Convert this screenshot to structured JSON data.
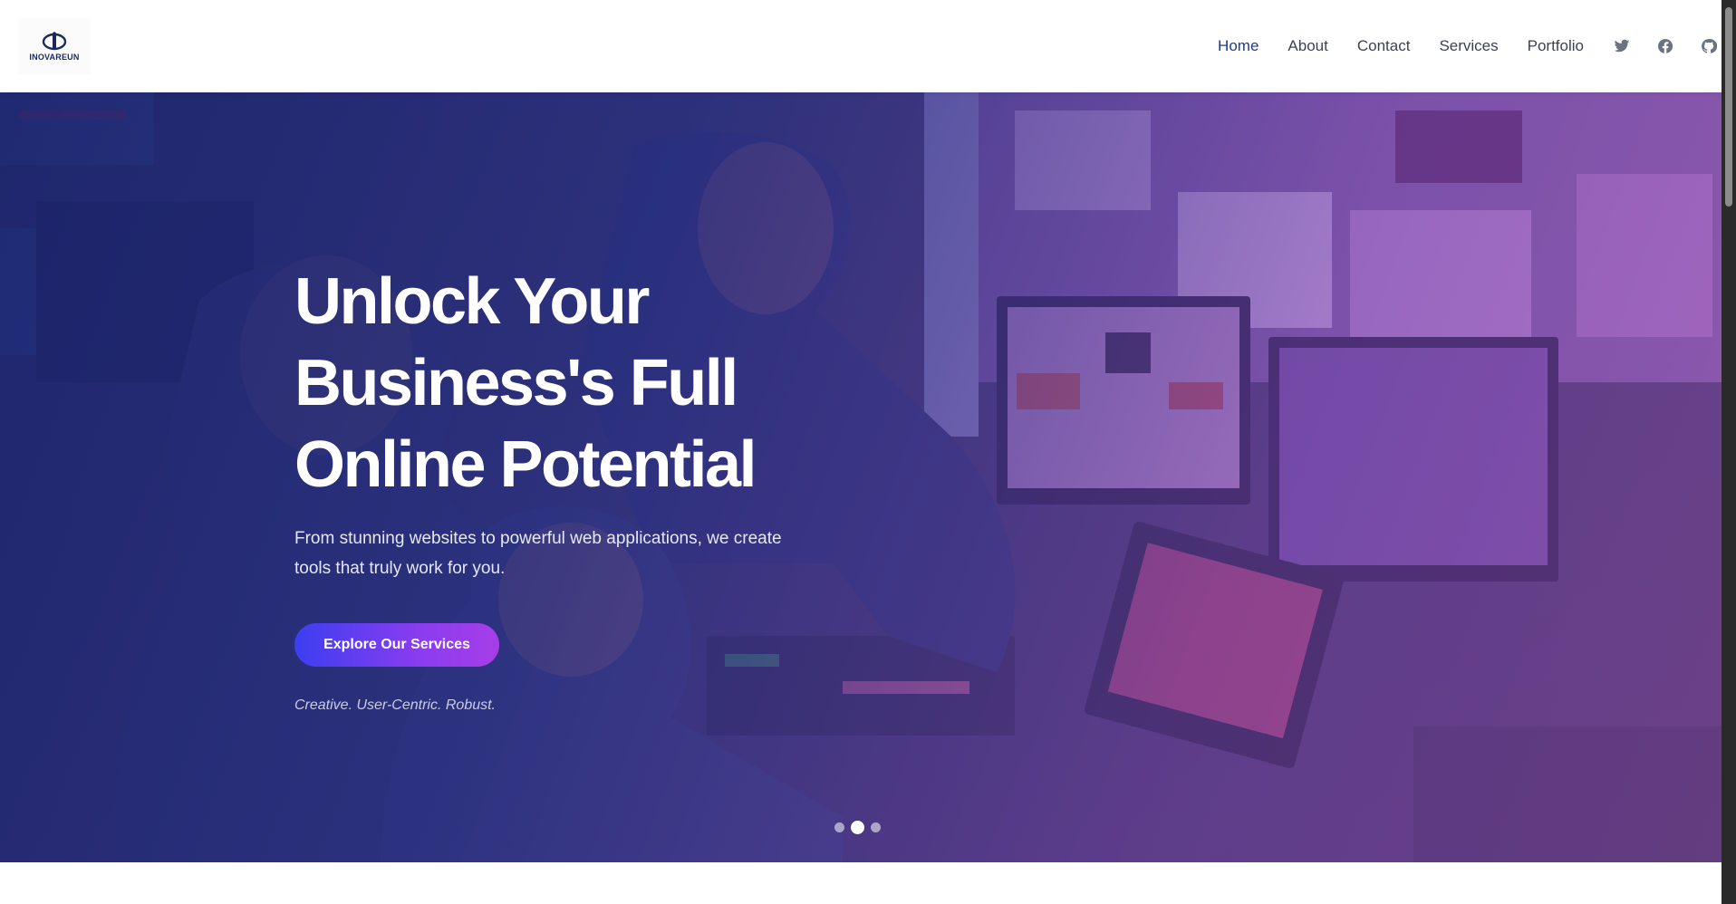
{
  "brand": {
    "name": "INOVAREUN",
    "icon": "logo-mark-icon"
  },
  "nav": {
    "items": [
      {
        "label": "Home",
        "active": true
      },
      {
        "label": "About",
        "active": false
      },
      {
        "label": "Contact",
        "active": false
      },
      {
        "label": "Services",
        "active": false
      },
      {
        "label": "Portfolio",
        "active": false
      }
    ],
    "social": [
      "twitter-icon",
      "facebook-icon",
      "github-icon"
    ]
  },
  "hero": {
    "title_line1": "Unlock Your",
    "title_line2": "Business's Full",
    "title_line3": "Online Potential",
    "subtitle": "From stunning websites to powerful web applications, we create tools that truly work for you.",
    "cta_label": "Explore Our Services",
    "tagline": "Creative. User-Centric. Robust.",
    "slides_total": 3,
    "active_slide": 2
  },
  "colors": {
    "nav_active": "#1e3a8a",
    "nav_text": "#3b4256",
    "cta_gradient_start": "#3b3ff0",
    "cta_gradient_end": "#a63ee8",
    "overlay_primary": "#1c246e",
    "overlay_accent": "#9646b4"
  }
}
